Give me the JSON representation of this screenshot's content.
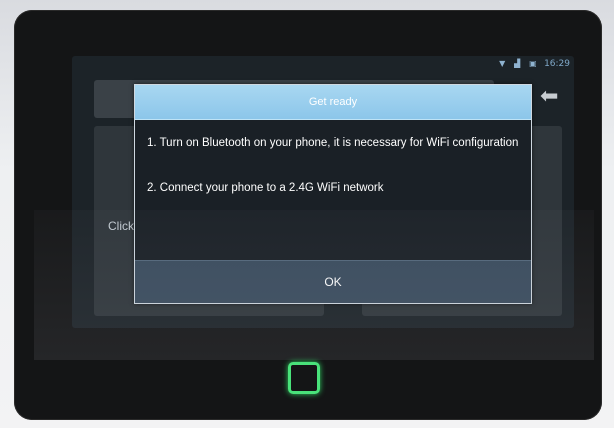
{
  "status_bar": {
    "time": "16:29",
    "icons": [
      "wifi-icon",
      "signal-icon",
      "battery-icon"
    ],
    "color": "#8fb3d0"
  },
  "background": {
    "click_text": "Click",
    "arrow_icon": "back-arrow-icon"
  },
  "dialog": {
    "title": "Get ready",
    "message1": "1. Turn on Bluetooth on your phone, it is necessary for WiFi configuration",
    "message2": "2. Connect your phone to a 2.4G WiFi network",
    "ok_label": "OK",
    "header_color": "#9bd0ee",
    "button_color": "#3a4c5e"
  },
  "device": {
    "home_button_icon": "home-square-icon",
    "home_button_color": "#49e27a"
  }
}
